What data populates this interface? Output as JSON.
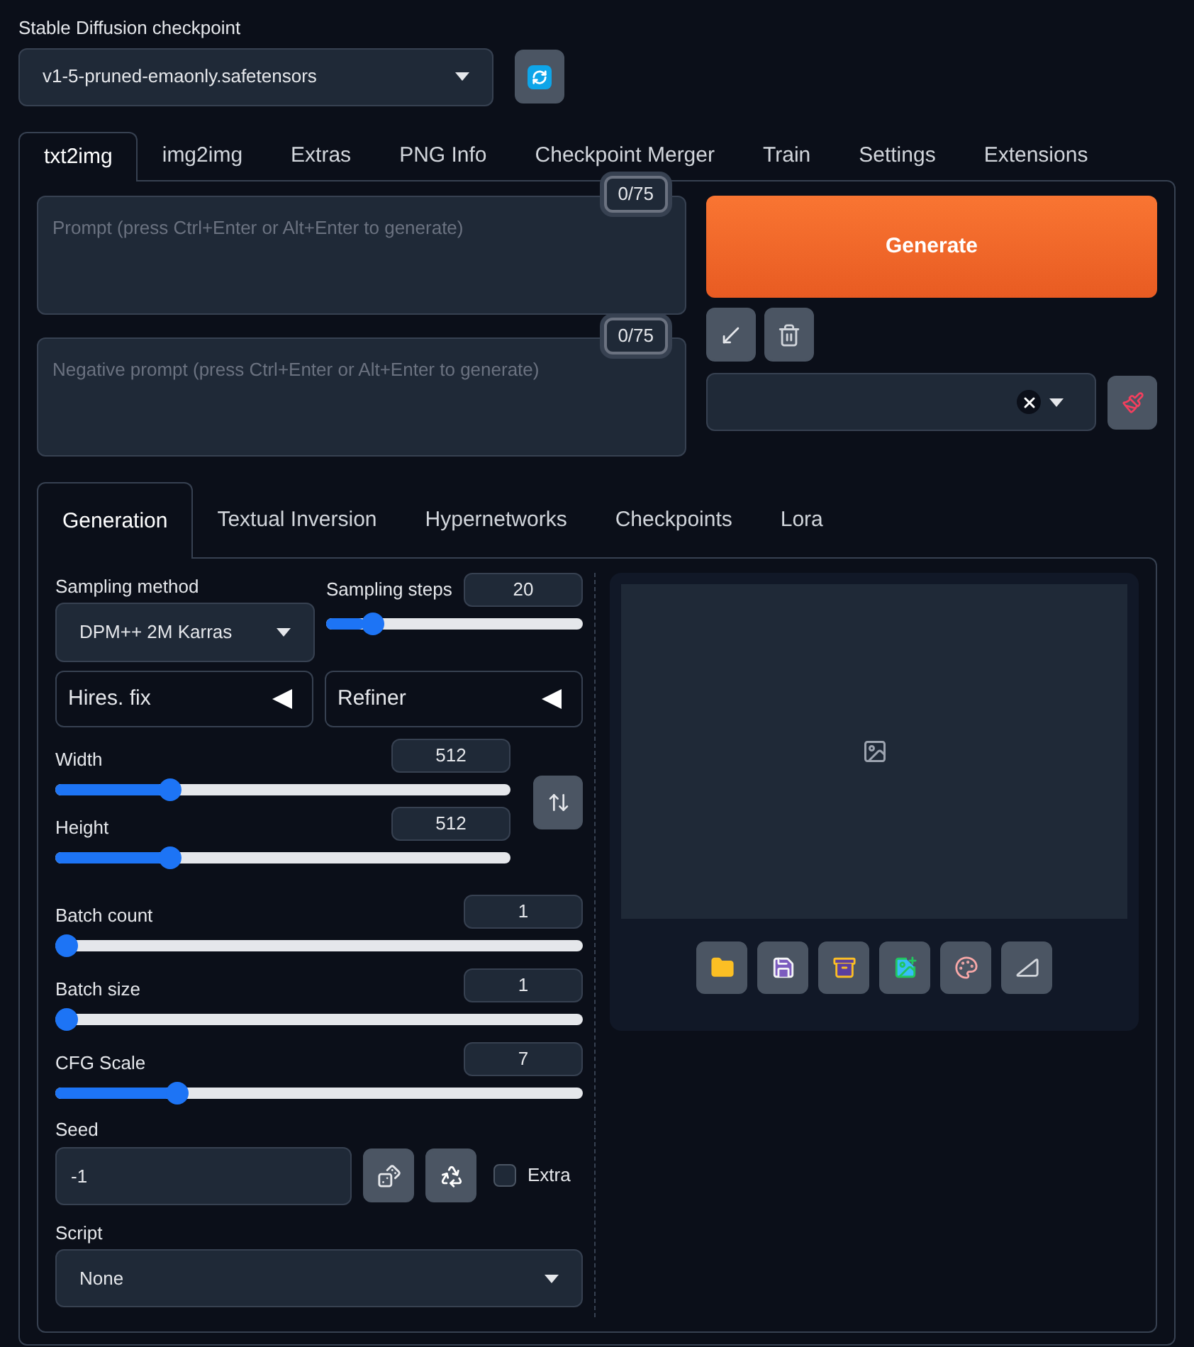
{
  "checkpoint": {
    "label": "Stable Diffusion checkpoint",
    "value": "v1-5-pruned-emaonly.safetensors"
  },
  "tabs": [
    {
      "label": "txt2img",
      "selected": true
    },
    {
      "label": "img2img",
      "selected": false
    },
    {
      "label": "Extras",
      "selected": false
    },
    {
      "label": "PNG Info",
      "selected": false
    },
    {
      "label": "Checkpoint Merger",
      "selected": false
    },
    {
      "label": "Train",
      "selected": false
    },
    {
      "label": "Settings",
      "selected": false
    },
    {
      "label": "Extensions",
      "selected": false
    }
  ],
  "prompt": {
    "placeholder": "Prompt (press Ctrl+Enter or Alt+Enter to generate)",
    "token_count": "0/75"
  },
  "negative_prompt": {
    "placeholder": "Negative prompt (press Ctrl+Enter or Alt+Enter to generate)",
    "token_count": "0/75"
  },
  "generate_button": "Generate",
  "subtabs": [
    {
      "label": "Generation",
      "selected": true
    },
    {
      "label": "Textual Inversion",
      "selected": false
    },
    {
      "label": "Hypernetworks",
      "selected": false
    },
    {
      "label": "Checkpoints",
      "selected": false
    },
    {
      "label": "Lora",
      "selected": false
    }
  ],
  "sampling_method": {
    "label": "Sampling method",
    "value": "DPM++ 2M Karras"
  },
  "sampling_steps": {
    "label": "Sampling steps",
    "value": "20",
    "level": 0.15
  },
  "accordions": [
    {
      "label": "Hires. fix",
      "expanded": false
    },
    {
      "label": "Refiner",
      "expanded": false
    }
  ],
  "width": {
    "label": "Width",
    "value": "512",
    "level": 0.24
  },
  "height": {
    "label": "Height",
    "value": "512",
    "level": 0.24
  },
  "batch_count": {
    "label": "Batch count",
    "value": "1",
    "level": 0
  },
  "batch_size": {
    "label": "Batch size",
    "value": "1",
    "level": 0
  },
  "cfg_scale": {
    "label": "CFG Scale",
    "value": "7",
    "level": 0.22
  },
  "seed": {
    "label": "Seed",
    "value": "-1"
  },
  "extra": {
    "label": "Extra",
    "checked": false
  },
  "script": {
    "label": "Script",
    "value": "None"
  }
}
